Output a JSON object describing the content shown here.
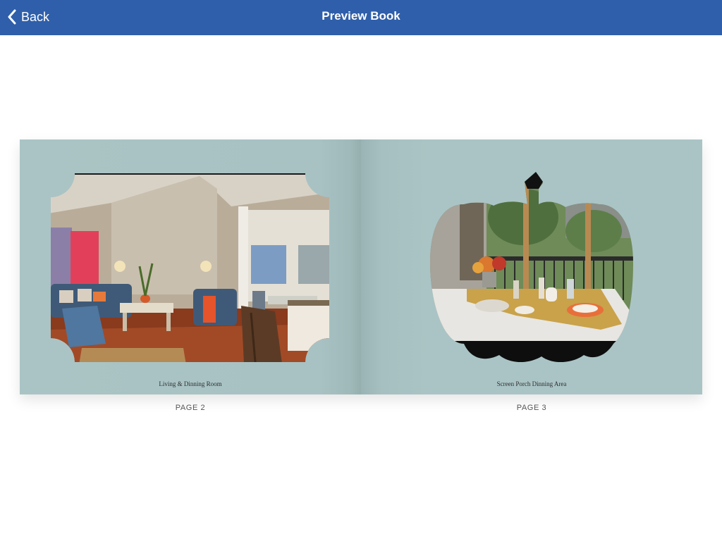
{
  "header": {
    "back_label": "Back",
    "title": "Preview Book",
    "background": "#2f5faa"
  },
  "book": {
    "page_color": "#aac4c5",
    "pages": [
      {
        "label": "PAGE 2",
        "caption": "Living  & Dinning Room",
        "frame_shape": "ticket-frame-with-scalloped-corners"
      },
      {
        "label": "PAGE 3",
        "caption": "Screen Porch Dinning Area",
        "frame_shape": "pumpkin-frame"
      }
    ]
  }
}
